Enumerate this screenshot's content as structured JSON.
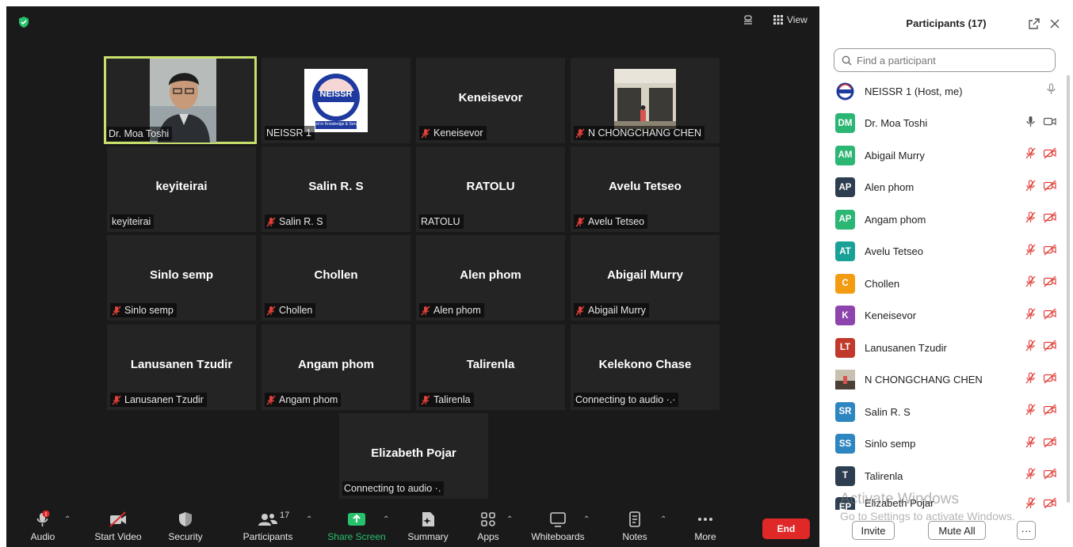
{
  "top": {
    "view_label": "View"
  },
  "tiles": [
    {
      "id": "dr-moa-toshi",
      "center": "",
      "tag": "Dr. Moa Toshi",
      "muted": false
    },
    {
      "id": "neissr-1",
      "center": "",
      "tag": "NEISSR 1",
      "muted": false
    },
    {
      "id": "keneisevor",
      "center": "Keneisevor",
      "tag": "Keneisevor",
      "muted": true
    },
    {
      "id": "n-chongchang-chen",
      "center": "",
      "tag": "N CHONGCHANG CHEN",
      "muted": true
    },
    {
      "id": "keyiteirai",
      "center": "keyiteirai",
      "tag": "keyiteirai",
      "muted": false
    },
    {
      "id": "salin-r-s",
      "center": "Salin R. S",
      "tag": "Salin R. S",
      "muted": true
    },
    {
      "id": "ratolu",
      "center": "RATOLU",
      "tag": "RATOLU",
      "muted": false
    },
    {
      "id": "avelu-tetseo",
      "center": "Avelu Tetseo",
      "tag": "Avelu Tetseo",
      "muted": true
    },
    {
      "id": "sinlo-semp",
      "center": "Sinlo semp",
      "tag": "Sinlo semp",
      "muted": true
    },
    {
      "id": "chollen",
      "center": "Chollen",
      "tag": "Chollen",
      "muted": true
    },
    {
      "id": "alen-phom",
      "center": "Alen phom",
      "tag": "Alen phom",
      "muted": true
    },
    {
      "id": "abigail-murry",
      "center": "Abigail Murry",
      "tag": "Abigail Murry",
      "muted": true
    },
    {
      "id": "lanusanen-tzudir",
      "center": "Lanusanen Tzudir",
      "tag": "Lanusanen Tzudir",
      "muted": true
    },
    {
      "id": "angam-phom",
      "center": "Angam phom",
      "tag": "Angam phom",
      "muted": true
    },
    {
      "id": "talirenla",
      "center": "Talirenla",
      "tag": "Talirenla",
      "muted": true
    },
    {
      "id": "kelekono-chase",
      "center": "Kelekono Chase",
      "tag": "Connecting to audio ·.·",
      "muted": false
    },
    {
      "id": "elizabeth-pojar",
      "center": "Elizabeth Pojar",
      "tag": "Connecting to audio ·.",
      "muted": false
    }
  ],
  "logo_text": {
    "name": "NEISSR",
    "tagline": "Excel in Knowledge & Service"
  },
  "toolbar": {
    "audio": "Audio",
    "audio_badge": "!",
    "start_video": "Start Video",
    "security": "Security",
    "participants": "Participants",
    "participants_count": "17",
    "share_screen": "Share Screen",
    "summary": "Summary",
    "apps": "Apps",
    "whiteboards": "Whiteboards",
    "notes": "Notes",
    "more": "More",
    "end": "End"
  },
  "panel": {
    "title": "Participants (17)",
    "search_placeholder": "Find a participant",
    "participants": [
      {
        "initials": "",
        "name": "NEISSR 1 (Host, me)",
        "color": "#ffffff",
        "type": "logo",
        "mic": "on-gray",
        "video": "none"
      },
      {
        "initials": "DM",
        "name": "Dr. Moa Toshi",
        "color": "#2bb673",
        "type": "initials",
        "mic": "on",
        "video": "on"
      },
      {
        "initials": "AM",
        "name": "Abigail Murry",
        "color": "#2bb673",
        "type": "initials",
        "mic": "off",
        "video": "off"
      },
      {
        "initials": "AP",
        "name": "Alen phom",
        "color": "#2c3e50",
        "type": "initials",
        "mic": "off",
        "video": "off"
      },
      {
        "initials": "AP",
        "name": "Angam phom",
        "color": "#2bb673",
        "type": "initials",
        "mic": "off",
        "video": "off"
      },
      {
        "initials": "AT",
        "name": "Avelu Tetseo",
        "color": "#1aa197",
        "type": "initials",
        "mic": "off",
        "video": "off"
      },
      {
        "initials": "C",
        "name": "Chollen",
        "color": "#f39c12",
        "type": "initials",
        "mic": "off",
        "video": "off"
      },
      {
        "initials": "K",
        "name": "Keneisevor",
        "color": "#8e44ad",
        "type": "initials",
        "mic": "off",
        "video": "off"
      },
      {
        "initials": "LT",
        "name": "Lanusanen Tzudir",
        "color": "#c0392b",
        "type": "initials",
        "mic": "off",
        "video": "off"
      },
      {
        "initials": "",
        "name": "N CHONGCHANG CHEN",
        "color": "#8a6d52",
        "type": "photo",
        "mic": "off",
        "video": "off"
      },
      {
        "initials": "SR",
        "name": "Salin R. S",
        "color": "#2e86c1",
        "type": "initials",
        "mic": "off",
        "video": "off"
      },
      {
        "initials": "SS",
        "name": "Sinlo semp",
        "color": "#2e86c1",
        "type": "initials",
        "mic": "off",
        "video": "off"
      },
      {
        "initials": "T",
        "name": "Talirenla",
        "color": "#2c3e50",
        "type": "initials",
        "mic": "off",
        "video": "off"
      },
      {
        "initials": "EP",
        "name": "Elizabeth Pojar",
        "color": "#2c3e50",
        "type": "initials",
        "mic": "off",
        "video": "off"
      }
    ],
    "invite": "Invite",
    "mute_all": "Mute All",
    "more": "···"
  },
  "watermark": {
    "line1": "Activate Windows",
    "line2": "Go to Settings to activate Windows."
  }
}
